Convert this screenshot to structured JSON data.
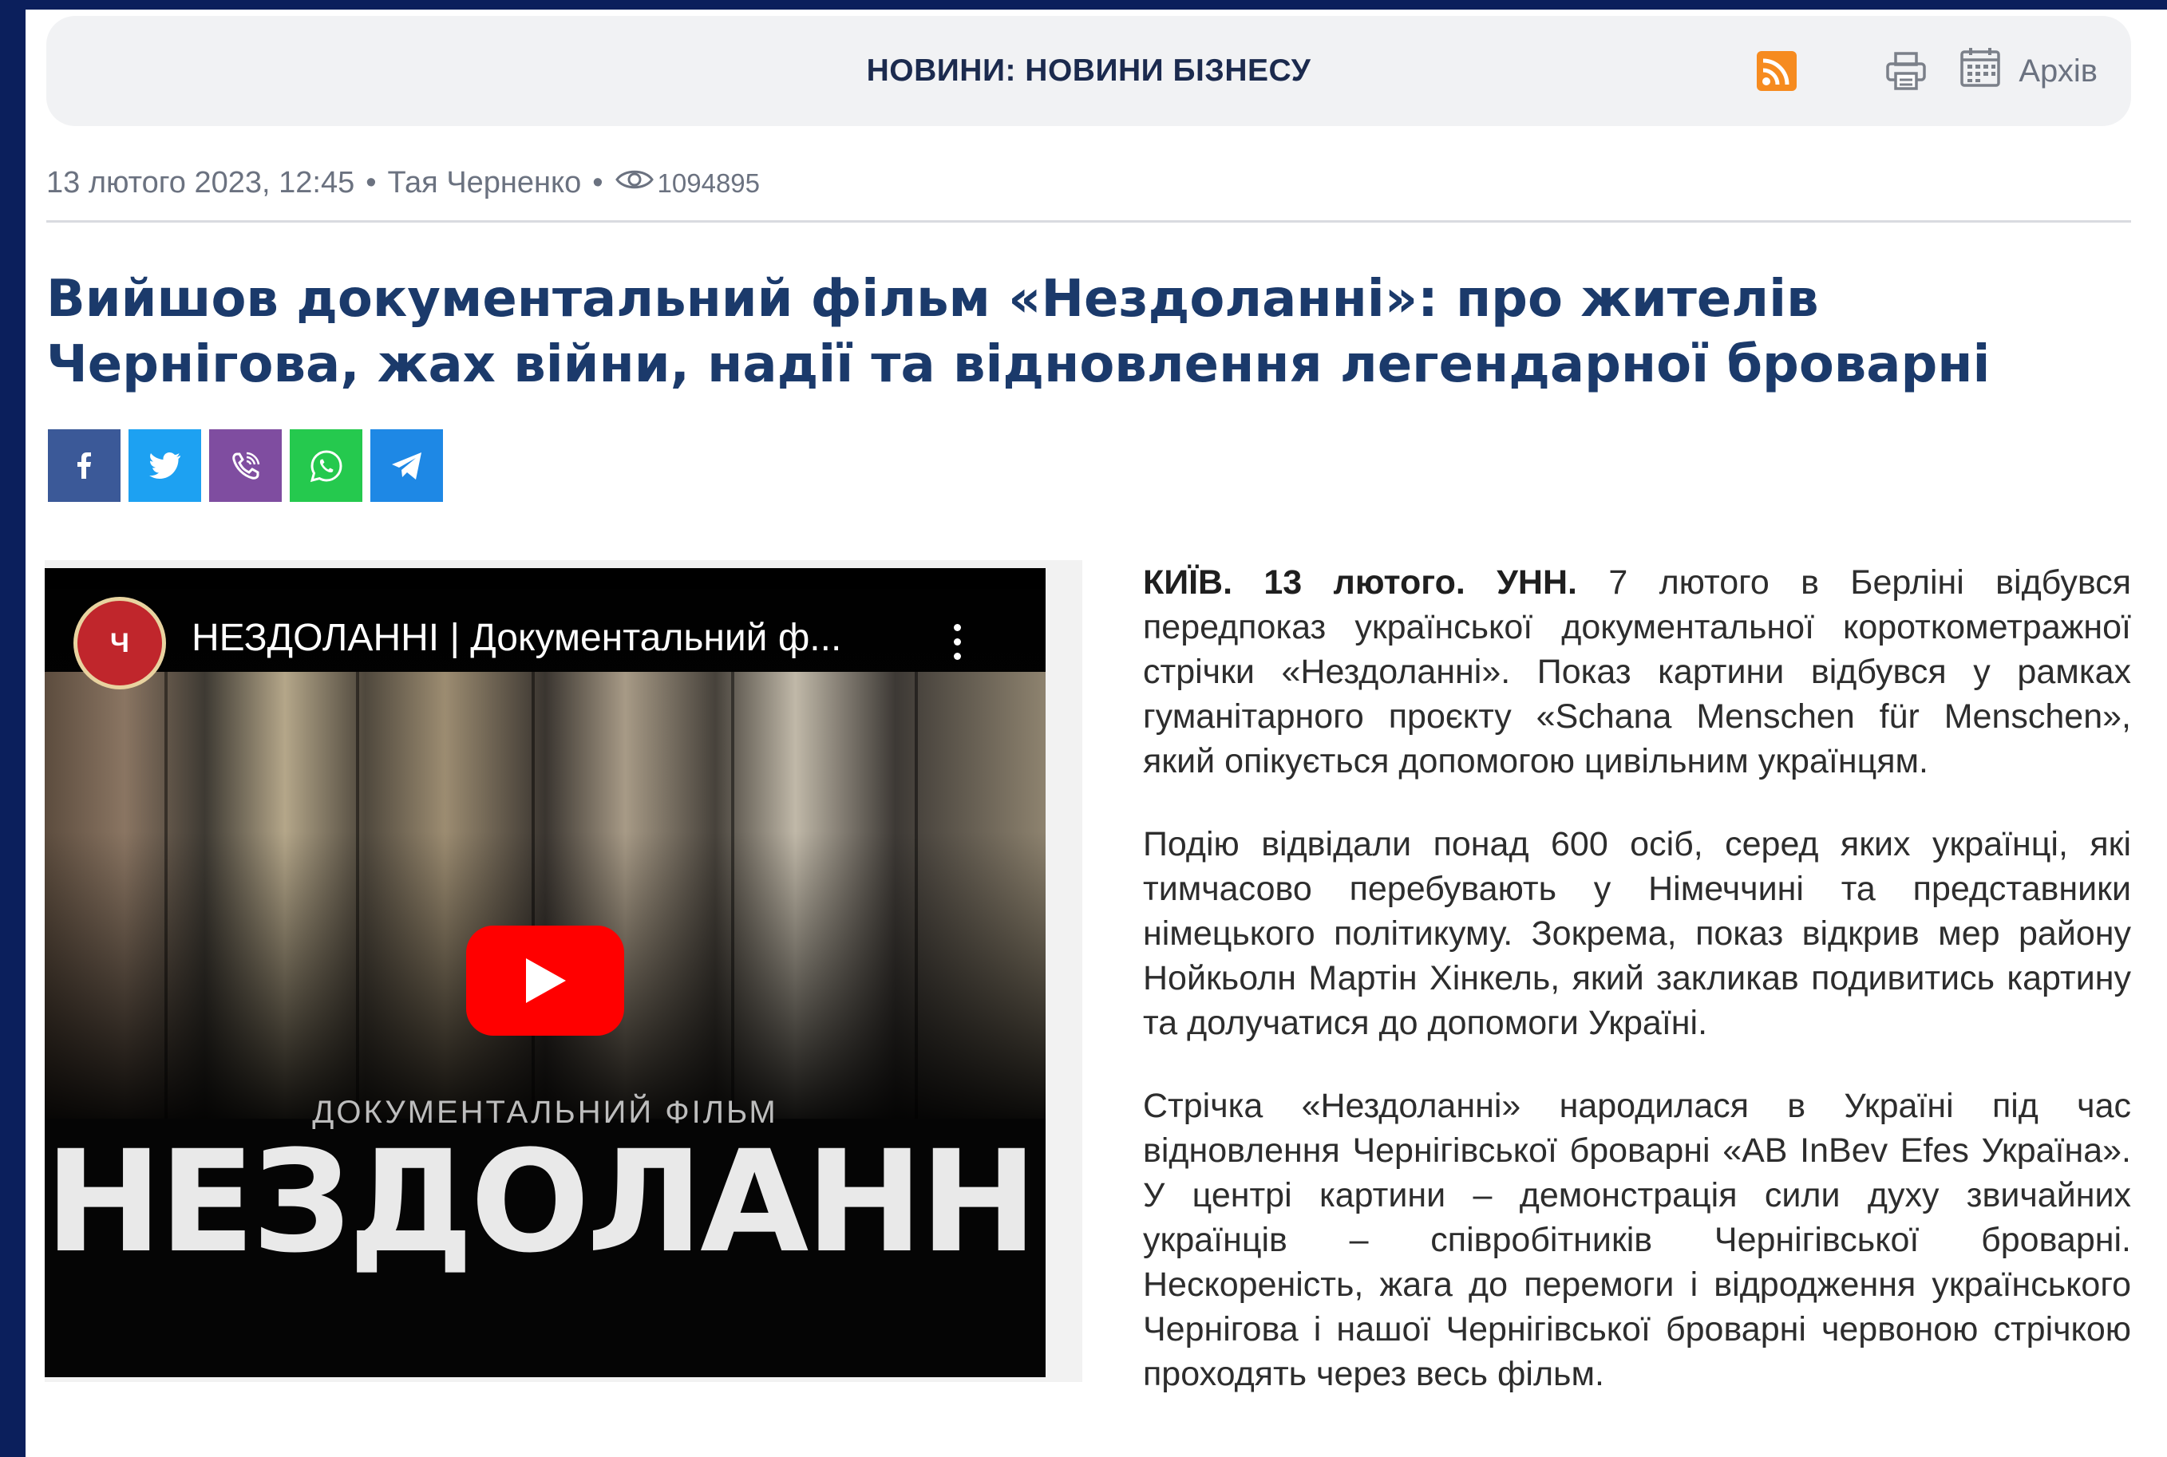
{
  "header": {
    "section": "НОВИНИ: НОВИНИ БІЗНЕСУ",
    "archive_label": "Архів",
    "icons": [
      "rss-icon",
      "print-icon",
      "calendar-icon"
    ]
  },
  "meta": {
    "datetime": "13 лютого 2023, 12:45",
    "author": "Тая Черненко",
    "separator": "•",
    "views": "1094895"
  },
  "article": {
    "title": "Вийшов документальний фільм «Нездоланні»: про жителів Чернігова, жах війни, надії та відновлення легендарної броварні",
    "lead_dateline": "КИЇВ. 13 лютого. УНН.",
    "paragraphs": [
      "7 лютого в Берліні відбувся передпоказ української документальної короткометражної стрічки «Нездоланні». Показ картини відбувся у рамках гуманітарного проєкту «Schana Menschen für Menschen», який опікується допомогою цивільним українцям.",
      "Подію відвідали понад 600 осіб, серед яких українці, які тимчасово перебувають у Німеччині та представники німецького політикуму. Зокрема, показ відкрив мер району Нойкьолн Мартін Хінкель, який закликав подивитись картину та долучатися до допомоги Україні.",
      "Стрічка «Нездоланні» народилася в Україні під час відновлення Чернігівської броварні «AB InBev Efes Україна». У центрі картини – демонстрація сили духу звичайних українців – співробітників Чернігівської броварні. Нескореність, жага до перемоги і відродження українського Чернігова і нашої Чернігівської броварні червоною стрічкою проходять через весь фільм."
    ]
  },
  "share": [
    "facebook-icon",
    "twitter-icon",
    "viber-icon",
    "whatsapp-icon",
    "telegram-icon"
  ],
  "video": {
    "title": "НЕЗДОЛАННІ | Документальний ф...",
    "caption": "ДОКУМЕНТАЛЬНИЙ ФІЛЬМ",
    "film_name": "НЕЗДОЛАННІ",
    "channel_logo_text": "Ч"
  },
  "colors": {
    "frame": "#0b1f5c",
    "title": "#1b3a6b",
    "rss": "#f68b1f",
    "facebook": "#3b5998",
    "twitter": "#1da1f2",
    "viber": "#7f4da0",
    "whatsapp": "#25c94e",
    "telegram": "#1e88e5",
    "youtube": "#ff0000"
  }
}
